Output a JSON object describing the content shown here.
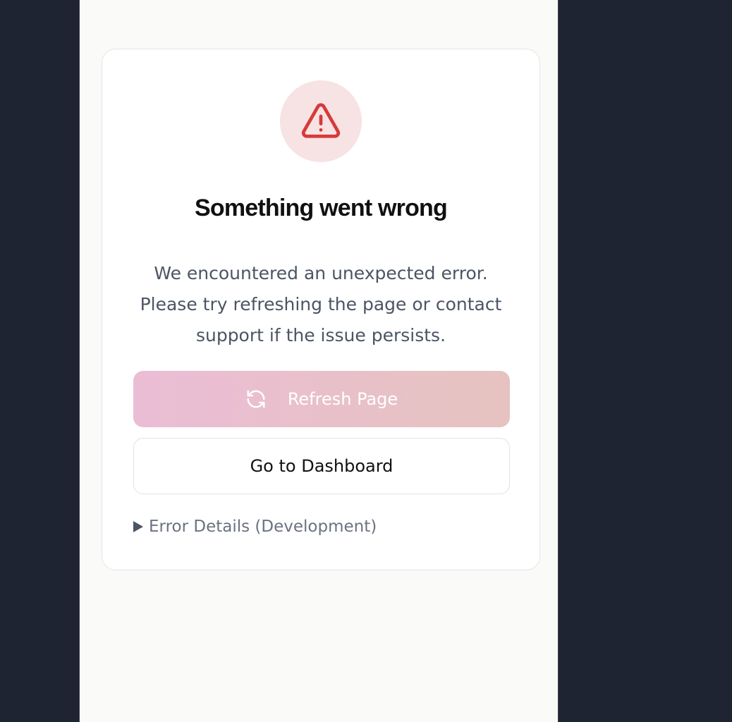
{
  "error_card": {
    "icon": "warning-triangle-icon",
    "title": "Something went wrong",
    "message": "We encountered an unexpected error. Please try refreshing the page or contact support if the issue persists.",
    "refresh_button": {
      "icon": "refresh-icon",
      "label": "Refresh Page"
    },
    "dashboard_button": {
      "label": "Go to Dashboard"
    },
    "details_toggle": {
      "icon": "disclosure-triangle-icon",
      "label": "Error Details (Development)",
      "expanded": false
    }
  },
  "colors": {
    "outer_background": "#1f2433",
    "page_background": "#fafaf8",
    "icon_circle": "#f7e3e3",
    "icon_stroke": "#d63a3a",
    "refresh_gradient_start": "#ebbdd5",
    "refresh_gradient_end": "#e6c3c0"
  }
}
